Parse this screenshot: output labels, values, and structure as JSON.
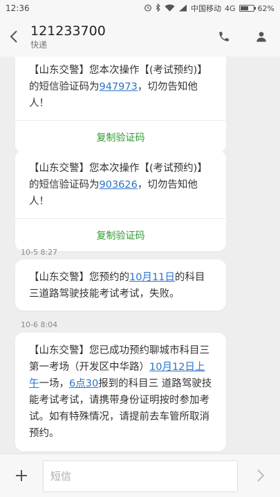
{
  "status_bar": {
    "time": "12:36",
    "carrier": "中国移动",
    "network": "4G",
    "battery_text": "62%",
    "battery_level": 0.62
  },
  "header": {
    "title": "121233700",
    "subtitle": "快递"
  },
  "messages": [
    {
      "pre": "【山东交警】您本次操作【(考试预约)】的短信验证码为",
      "link": "947973",
      "post": "，切勿告知他人！",
      "action": "复制验证码"
    },
    {
      "pre": "【山东交警】您本次操作【(考试预约)】的短信验证码为",
      "link": "903626",
      "post": "，切勿告知他人！",
      "action": "复制验证码"
    },
    {
      "timestamp": "10-5 8:27",
      "pre": "【山东交警】您预约的",
      "link": "10月11日",
      "post": "的科目三道路驾驶技能考试考试，失败。"
    },
    {
      "timestamp": "10-6 8:04",
      "pre": "【山东交警】您已成功预约聊城市科目三第一考场（开发区中华路）",
      "link1": "10月12日上午",
      "mid": "一场，",
      "link2": "6点30",
      "post": "报到的科目三 道路驾驶技能考试考试，请携带身份证明按时参加考试。如有特殊情况，请提前去车管所取消预约。"
    }
  ],
  "input": {
    "placeholder": "短信"
  },
  "colors": {
    "link": "#2a73c9",
    "action": "#2f9a2f",
    "background": "#eeeeee"
  }
}
